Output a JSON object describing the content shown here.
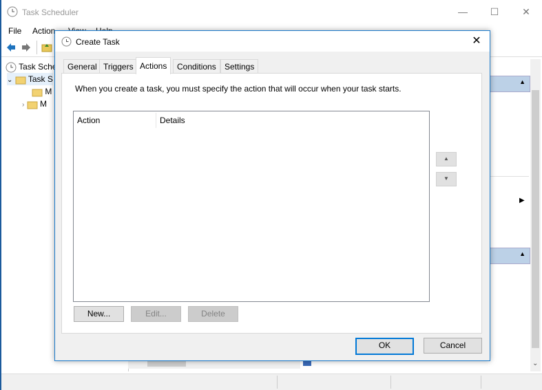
{
  "app": {
    "title": "Task Scheduler",
    "menu": [
      "File",
      "Action",
      "View",
      "Help"
    ],
    "tree": [
      "Task Sche",
      "Task S",
      "M",
      "M"
    ]
  },
  "dialog": {
    "title": "Create Task",
    "tabs": [
      "General",
      "Triggers",
      "Actions",
      "Conditions",
      "Settings"
    ],
    "active_tab": "Actions",
    "info_text": "When you create a task, you must specify the action that will occur when your task starts.",
    "columns": [
      "Action",
      "Details"
    ],
    "buttons": {
      "new": "New...",
      "edit": "Edit...",
      "delete": "Delete",
      "ok": "OK",
      "cancel": "Cancel"
    }
  },
  "colors": {
    "accent": "#0078d7",
    "header_blue": "#bcd1e7",
    "desktop": "#1b5a9c"
  }
}
